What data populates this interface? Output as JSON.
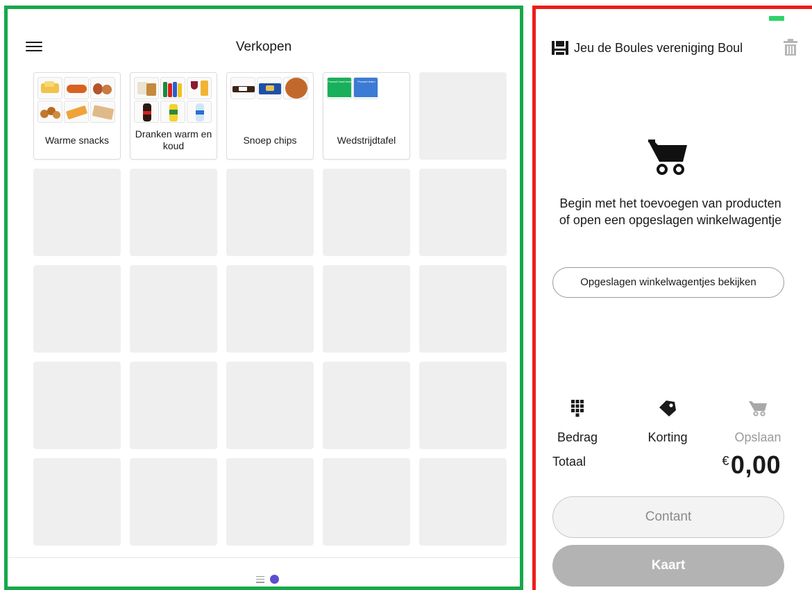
{
  "left": {
    "title": "Verkopen",
    "categories": [
      {
        "label": "Warme snacks"
      },
      {
        "label": "Dranken warm en koud"
      },
      {
        "label": "Snoep chips"
      },
      {
        "label": "Wedstrijdtafel"
      }
    ],
    "empty_tiles": 21,
    "wedstrijdtafel_thumbs": [
      {
        "text": "Poussel Kaart leden",
        "color": "#18b05a"
      },
      {
        "text": "Poussel leden",
        "color": "#3b7bd4"
      }
    ],
    "pager": {
      "active_page": 1,
      "pages": 1
    }
  },
  "right": {
    "register_name": "Jeu de Boules vereniging Boul",
    "empty_message": "Begin met het toevoegen van producten of open een opgeslagen winkelwagentje",
    "saved_carts_button": "Opgeslagen winkelwagentjes bekijken",
    "actions": [
      {
        "label": "Bedrag",
        "icon": "keypad-icon",
        "enabled": true
      },
      {
        "label": "Korting",
        "icon": "tag-icon",
        "enabled": true
      },
      {
        "label": "Opslaan",
        "icon": "cart-icon",
        "enabled": false
      }
    ],
    "total_label": "Totaal",
    "total_currency": "€",
    "total_amount": "0,00",
    "pay_cash": "Contant",
    "pay_card": "Kaart"
  },
  "colors": {
    "left_frame": "#17a84a",
    "right_frame": "#ee1c1c",
    "accent_dot": "#5b4fcf",
    "battery": "#2fd26a"
  }
}
